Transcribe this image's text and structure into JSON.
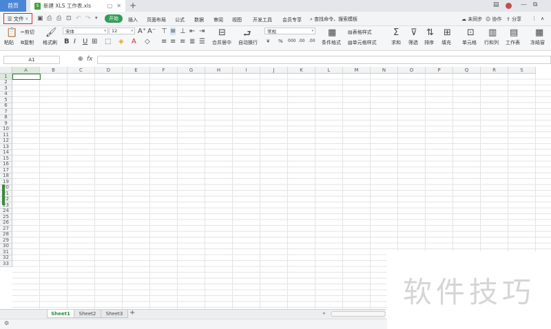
{
  "tabbar": {
    "home_label": "首页",
    "doc_title": "新建 XLS 工作表.xls",
    "doc_icon": "S",
    "new_tab": "+"
  },
  "window": {
    "minimize": "—",
    "restore": "⧉"
  },
  "menu": {
    "file_label": "文件",
    "start_label": "开始",
    "tabs": [
      "插入",
      "页面布局",
      "公式",
      "数据",
      "审阅",
      "视图",
      "开发工具",
      "会员专享"
    ],
    "search": "查找命令、搜索模板",
    "sync": "未同步",
    "collab": "协作",
    "share": "分享"
  },
  "ribbon": {
    "paste": "粘贴",
    "cut": "剪切",
    "copy": "复制",
    "format_painter": "格式刷",
    "font_name": "宋体",
    "font_size": "12",
    "bold": "B",
    "italic": "I",
    "underline": "U",
    "merge_center": "合并居中",
    "wrap_text": "自动换行",
    "number_format": "常规",
    "currency": "¥",
    "percent": "%",
    "thousands": "000",
    "inc_decimal": ".00",
    "dec_decimal": ".00",
    "conditional_format": "条件格式",
    "table_style": "表格样式",
    "cell_style": "单元格样式",
    "sum": "求和",
    "filter": "筛选",
    "sort": "排序",
    "fill": "填充",
    "cell": "单元格",
    "row_col": "行和列",
    "worksheet": "工作表",
    "freeze": "冻结窗"
  },
  "formula_bar": {
    "cell_ref": "A1",
    "fx": "fx"
  },
  "columns": [
    "A",
    "B",
    "C",
    "D",
    "E",
    "F",
    "G",
    "H",
    "I",
    "J",
    "K",
    "L",
    "M",
    "N",
    "O",
    "P",
    "Q",
    "R",
    "S"
  ],
  "rows": [
    "1",
    "2",
    "3",
    "4",
    "5",
    "6",
    "7",
    "8",
    "9",
    "10",
    "11",
    "12",
    "13",
    "14",
    "15",
    "16",
    "17",
    "18",
    "19",
    "20",
    "21",
    "22",
    "23",
    "24",
    "25",
    "26",
    "27",
    "28",
    "29",
    "30",
    "31",
    "32",
    "33"
  ],
  "sheets": [
    "Sheet1",
    "Sheet2",
    "Sheet3"
  ],
  "add_sheet": "+",
  "watermark": "软件技巧",
  "colors": {
    "accent_green": "#2f9e54",
    "home_blue": "#4a86d6",
    "highlight_red": "#d9242a"
  }
}
